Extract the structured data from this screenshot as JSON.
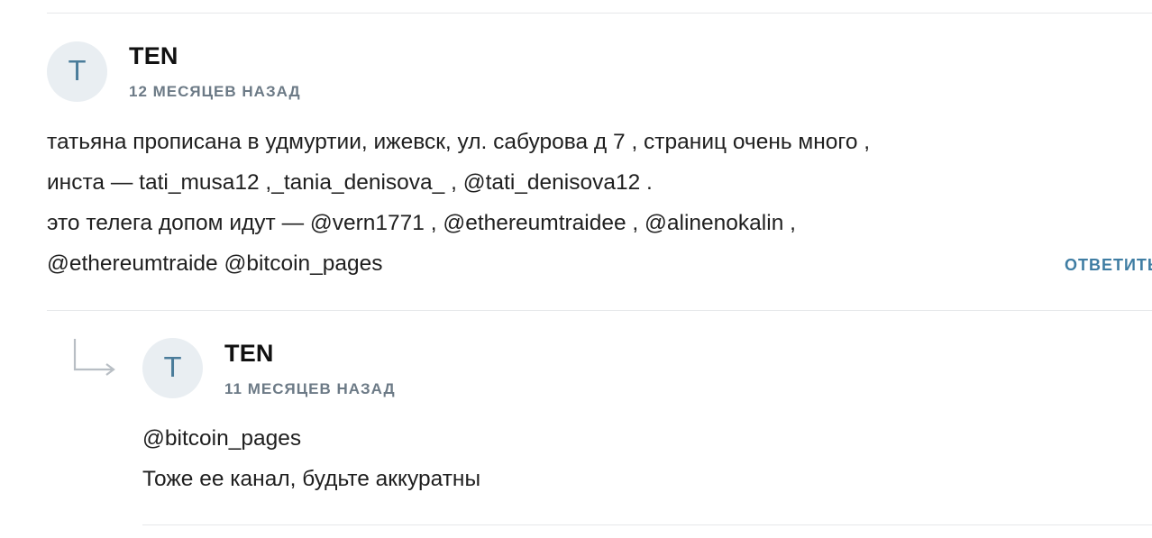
{
  "comments": [
    {
      "avatar_letter": "T",
      "author": "TEN",
      "time": "12 месяцев назад",
      "lines": [
        "татьяна прописана в удмуртии, ижевск, ул. сабурова д 7 , страниц очень много ,",
        "инста — tati_musa12 ,_tania_denisova_ , @tati_denisova12 .",
        "это телега допом идут — @vern1771 , @ethereumtraidee , @alinenokalin ,",
        "@ethereumtraide @bitcoin_pages"
      ],
      "reply_label": "ОТВЕТИТЬ"
    },
    {
      "avatar_letter": "T",
      "author": "TEN",
      "time": "11 месяцев назад",
      "lines": [
        "@bitcoin_pages",
        "Тоже ее канал, будьте аккуратны"
      ]
    }
  ],
  "colors": {
    "avatar_bg": "#e9eef2",
    "avatar_text": "#4a7c9a",
    "reply_link": "#3f7da3",
    "meta_text": "#6c7a86"
  },
  "icons": {
    "reply_arrow": "reply-arrow-icon"
  }
}
